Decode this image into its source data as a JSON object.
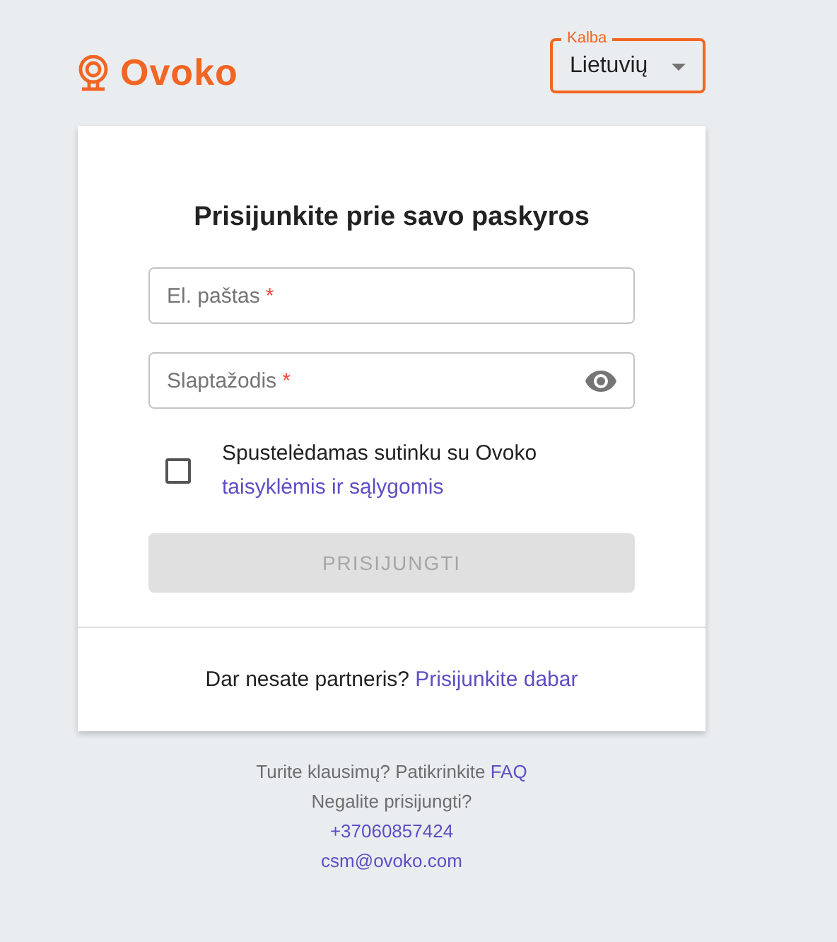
{
  "header": {
    "logo_text": "Ovoko",
    "language_select": {
      "label": "Kalba",
      "value": "Lietuvių"
    }
  },
  "login_card": {
    "title": "Prisijunkite prie savo paskyros",
    "fields": [
      {
        "kind": "text",
        "placeholder": "El. paštas",
        "required_mark": "*"
      },
      {
        "kind": "password",
        "placeholder": "Slaptažodis",
        "required_mark": "*"
      }
    ],
    "terms": {
      "checked": false,
      "text": "Spustelėdamas sutinku su Ovoko",
      "link": "taisyklėmis ir sąlygomis"
    },
    "submit": {
      "label": "PRISIJUNGTI",
      "disabled": true
    },
    "signup": {
      "text": "Dar nesate partneris?",
      "link": "Prisijunkite dabar"
    }
  },
  "footer": {
    "question": "Turite klausimų? Patikrinkite",
    "faq": "FAQ",
    "cant_login": "Negalite prisijungti?",
    "phone": "+37060857424",
    "email": "csm@ovoko.com"
  }
}
